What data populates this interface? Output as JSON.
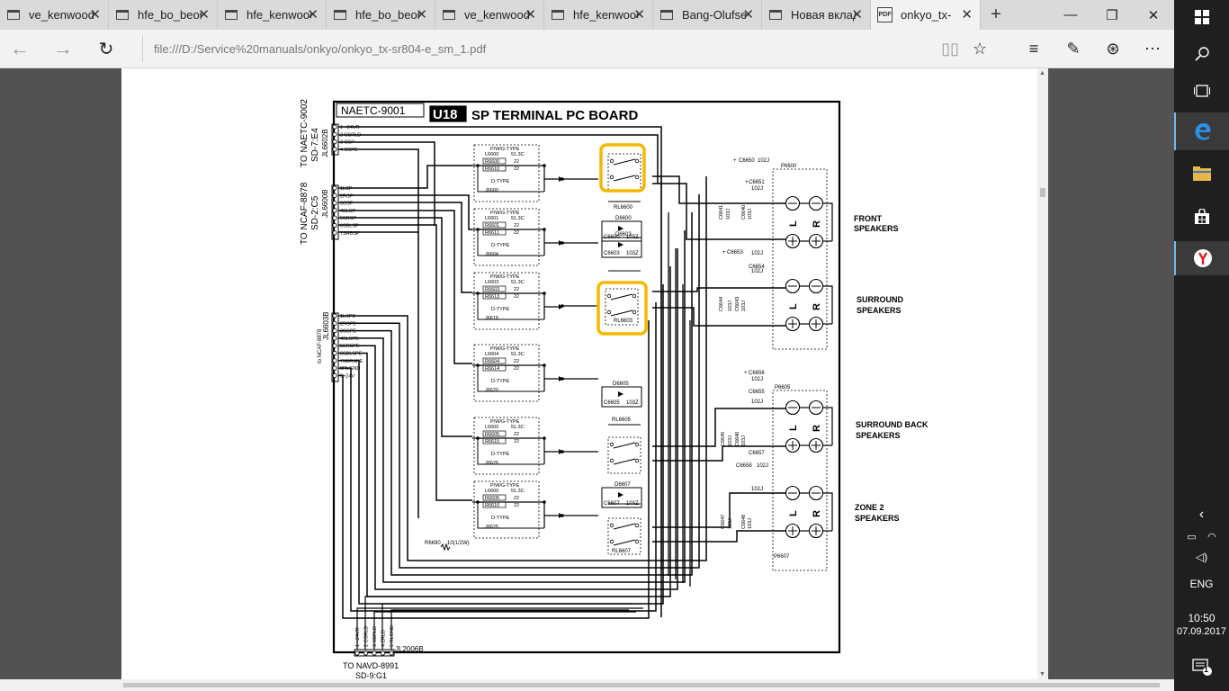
{
  "tabs": [
    {
      "title": "ve_kenwood_",
      "icon": "page-icon"
    },
    {
      "title": "hfe_bo_beom",
      "icon": "page-icon"
    },
    {
      "title": "hfe_kenwood",
      "icon": "page-icon"
    },
    {
      "title": "hfe_bo_beom",
      "icon": "page-icon"
    },
    {
      "title": "ve_kenwood_",
      "icon": "page-icon"
    },
    {
      "title": "hfe_kenwood",
      "icon": "page-icon"
    },
    {
      "title": "Bang-Olufsen",
      "icon": "page-icon"
    },
    {
      "title": "Новая вкладк",
      "icon": "page-icon"
    },
    {
      "title": "onkyo_tx-",
      "icon": "pdf-icon",
      "badge": "PDF"
    }
  ],
  "address": {
    "url": "file:///D:/Service%20manuals/onkyo/onkyo_tx-sr804-e_sm_1.pdf"
  },
  "schematic": {
    "board_id": "NAETC-9001",
    "board_code": "U18",
    "board_title": "SP TERMINAL PC BOARD",
    "connectors": {
      "jl6602b": {
        "title1": "TO NAETC-9002",
        "title2": "SD-7:E4",
        "ref": "JL6602B",
        "pins": [
          "1  +24VR",
          "2  CSRLD",
          "3  CSP",
          "4  CSPE"
        ]
      },
      "jl6600b": {
        "title1": "TO NCAF-8878",
        "title2": "SD-2:C5",
        "ref": "JL6600B",
        "pins": [
          "1LSP",
          "2RSP",
          "3CSP",
          "4SLSP",
          "5SRSP",
          "6SBLSP",
          "7SRBSP"
        ]
      },
      "jl6603b": {
        "title1": "to NCAF-8878",
        "ref": "JL6603B",
        "pins": [
          "1LSPE",
          "2RSPE",
          "3CSPE",
          "4SLSPE",
          "5SRSPE",
          "6SBLSPE",
          "7SBRSPE",
          "8RLGND",
          "9+24V"
        ]
      },
      "jl2006b": {
        "ref": "JL2006B",
        "title1": "TO NAVD-8991",
        "title2": "SD-9:G1",
        "pins": [
          "1  +24VR",
          "2  CSRLD",
          "3  SBRLD",
          "4  ZRLD",
          "5  RLGND"
        ]
      }
    },
    "filter_blocks": [
      {
        "type": "P/W/G-TYPE",
        "l": "L6600",
        "c": "51.3C",
        "r1": "R6600",
        "r2": "R6610",
        "val": "22",
        "dtype": "D-TYPE",
        "j": "J6600"
      },
      {
        "type": "P/W/G-TYPE",
        "l": "L6601",
        "c": "51.3C",
        "r1": "R6601",
        "r2": "R6611",
        "val": "22",
        "dtype": "D-TYPE",
        "j": "J6604"
      },
      {
        "type": "P/W/G-TYPE",
        "l": "L6603",
        "c": "51.3C",
        "r1": "R6603",
        "r2": "R6613",
        "val": "22",
        "dtype": "D-TYPE",
        "j": "J6618"
      },
      {
        "type": "P/W/G-TYPE",
        "l": "L6604",
        "c": "51.3C",
        "r1": "R6604",
        "r2": "R6614",
        "val": "22",
        "dtype": "D-TYPE",
        "j": "J6620"
      },
      {
        "type": "P/W/G-TYPE",
        "l": "L6605",
        "c": "51.3C",
        "r1": "R6605",
        "r2": "R6615",
        "val": "22",
        "dtype": "D-TYPE",
        "j": "J6626"
      },
      {
        "type": "P/W/G-TYPE",
        "l": "L6606",
        "c": "51.3C",
        "r1": "R6606",
        "r2": "R6616",
        "val": "22",
        "dtype": "D-TYPE",
        "j": "J6625"
      }
    ],
    "relays": {
      "rl6600": "RL6600",
      "rl6603": "RL6603",
      "rl6605": "RL6605",
      "rl6607": "RL6607"
    },
    "diodes": {
      "d6600": "D6600",
      "d6603": "D6603",
      "d6605": "D6605",
      "d6607": "D6607"
    },
    "caps": {
      "c6600": "C6600",
      "c6603": "C6603",
      "c6605": "C6605",
      "c6607": "C6607",
      "val": "103Z",
      "c6650": "C6650",
      "c6651": "C6651",
      "c6653": "C6653",
      "c6654": "C6654",
      "c6656": "C6656",
      "c6655": "C6655",
      "c6657": "C6657",
      "c6658": "C6658",
      "c6640": "C6640",
      "c6641": "C6641",
      "c6643": "C6643",
      "c6644": "C6644",
      "c6645": "C6645",
      "c6646": "C6646",
      "c6647": "C6647",
      "c6648": "C6648",
      "v102": "102J",
      "v103": "103J",
      "plus": "+"
    },
    "resistor": {
      "ref": "R6690",
      "val": "10(1/2W)"
    },
    "terminals": {
      "p6600": "P6600",
      "p6605": "P6605",
      "p6607": "P6607",
      "L": "L",
      "R": "R"
    },
    "speaker_groups": [
      {
        "line1": "FRONT",
        "line2": "SPEAKERS"
      },
      {
        "line1": "SURROUND",
        "line2": "SPEAKERS"
      },
      {
        "line1": "SURROUND BACK",
        "line2": "SPEAKERS"
      },
      {
        "line1": "ZONE 2",
        "line2": "SPEAKERS"
      }
    ],
    "highlight_color": "#f5b800"
  },
  "system": {
    "lang": "ENG",
    "time": "10:50",
    "date": "07.09.2017",
    "notifications": "1"
  }
}
